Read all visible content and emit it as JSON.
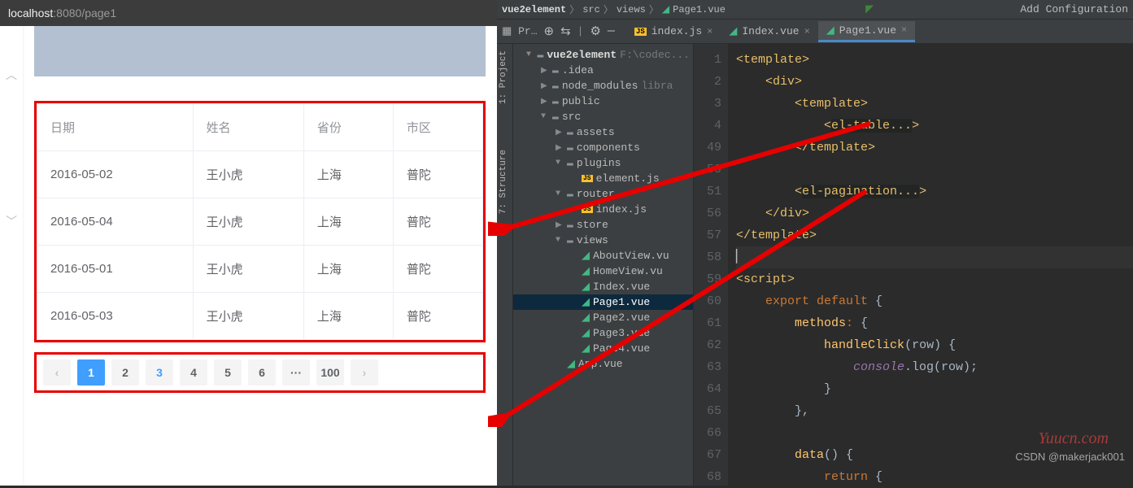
{
  "browser": {
    "host": "localhost",
    "port": ":8080",
    "path": "/page1"
  },
  "table": {
    "headers": [
      "日期",
      "姓名",
      "省份",
      "市区"
    ],
    "rows": [
      {
        "date": "2016-05-02",
        "name": "王小虎",
        "province": "上海",
        "city": "普陀"
      },
      {
        "date": "2016-05-04",
        "name": "王小虎",
        "province": "上海",
        "city": "普陀"
      },
      {
        "date": "2016-05-01",
        "name": "王小虎",
        "province": "上海",
        "city": "普陀"
      },
      {
        "date": "2016-05-03",
        "name": "王小虎",
        "province": "上海",
        "city": "普陀"
      }
    ]
  },
  "pagination": {
    "prev": "‹",
    "pages": [
      "1",
      "2",
      "3",
      "4",
      "5",
      "6",
      "···",
      "100"
    ],
    "next": "›"
  },
  "ide": {
    "breadcrumbs": [
      "vue2element",
      "src",
      "views",
      "Page1.vue"
    ],
    "add_cfg": "Add Configuration",
    "side_project": "1: Project",
    "side_structure": "7: Structure",
    "project_toolbar": "Pr…",
    "tabs": [
      {
        "icon": "js",
        "label": "index.js",
        "close": true
      },
      {
        "icon": "vue",
        "label": "Index.vue",
        "close": true
      },
      {
        "icon": "vue",
        "label": "Page1.vue",
        "close": true,
        "active": true
      }
    ],
    "tree": [
      {
        "ind": 1,
        "arrow": "▼",
        "icon": "fold",
        "label": "vue2element",
        "bold": true,
        "trail": "F:\\codec..."
      },
      {
        "ind": 2,
        "arrow": "▶",
        "icon": "fold",
        "label": ".idea"
      },
      {
        "ind": 2,
        "arrow": "▶",
        "icon": "fold",
        "label": "node_modules",
        "trail": "libra"
      },
      {
        "ind": 2,
        "arrow": "▶",
        "icon": "fold",
        "label": "public"
      },
      {
        "ind": 2,
        "arrow": "▼",
        "icon": "fold",
        "label": "src"
      },
      {
        "ind": 3,
        "arrow": "▶",
        "icon": "fold",
        "label": "assets"
      },
      {
        "ind": 3,
        "arrow": "▶",
        "icon": "fold",
        "label": "components"
      },
      {
        "ind": 3,
        "arrow": "▼",
        "icon": "fold",
        "label": "plugins"
      },
      {
        "ind": 4,
        "arrow": "",
        "icon": "js",
        "label": "element.js"
      },
      {
        "ind": 3,
        "arrow": "▼",
        "icon": "fold",
        "label": "router"
      },
      {
        "ind": 4,
        "arrow": "",
        "icon": "js",
        "label": "index.js"
      },
      {
        "ind": 3,
        "arrow": "▶",
        "icon": "fold",
        "label": "store"
      },
      {
        "ind": 3,
        "arrow": "▼",
        "icon": "fold",
        "label": "views"
      },
      {
        "ind": 4,
        "arrow": "",
        "icon": "vue",
        "label": "AboutView.vu"
      },
      {
        "ind": 4,
        "arrow": "",
        "icon": "vue",
        "label": "HomeView.vu"
      },
      {
        "ind": 4,
        "arrow": "",
        "icon": "vue",
        "label": "Index.vue"
      },
      {
        "ind": 4,
        "arrow": "",
        "icon": "vue",
        "label": "Page1.vue",
        "sel": true
      },
      {
        "ind": 4,
        "arrow": "",
        "icon": "vue",
        "label": "Page2.vue"
      },
      {
        "ind": 4,
        "arrow": "",
        "icon": "vue",
        "label": "Page3.vue"
      },
      {
        "ind": 4,
        "arrow": "",
        "icon": "vue",
        "label": "Page4.vue"
      },
      {
        "ind": 3,
        "arrow": "",
        "icon": "vue",
        "label": "App.vue"
      }
    ],
    "editor": {
      "lines": [
        {
          "n": "1",
          "d": 0,
          "seg": [
            {
              "c": "c-tag",
              "t": "<template>"
            }
          ]
        },
        {
          "n": "2",
          "d": 1,
          "seg": [
            {
              "c": "c-tag",
              "t": "<div>"
            }
          ]
        },
        {
          "n": "3",
          "d": 2,
          "seg": [
            {
              "c": "c-tag",
              "t": "<template>"
            }
          ]
        },
        {
          "n": "4",
          "d": 3,
          "seg": [
            {
              "c": "c-tag",
              "t": "<"
            },
            {
              "c": "c-comp",
              "t": "el-table..."
            },
            {
              "c": "c-tag",
              "t": ">"
            }
          ]
        },
        {
          "n": "49",
          "d": 2,
          "seg": [
            {
              "c": "c-tag",
              "t": "</template>"
            }
          ]
        },
        {
          "n": "50",
          "d": 0,
          "seg": []
        },
        {
          "n": "51",
          "d": 2,
          "seg": [
            {
              "c": "c-tag",
              "t": "<"
            },
            {
              "c": "c-comp",
              "t": "el-pagination..."
            },
            {
              "c": "c-tag",
              "t": ">"
            }
          ]
        },
        {
          "n": "56",
          "d": 1,
          "seg": [
            {
              "c": "c-tag",
              "t": "</div>"
            }
          ]
        },
        {
          "n": "57",
          "d": 0,
          "seg": [
            {
              "c": "c-tag",
              "t": "</template>"
            }
          ]
        },
        {
          "n": "58",
          "d": 0,
          "seg": [],
          "caret": true
        },
        {
          "n": "59",
          "d": 0,
          "seg": [
            {
              "c": "c-tag",
              "t": "<script>"
            }
          ]
        },
        {
          "n": "60",
          "d": 1,
          "seg": [
            {
              "c": "c-kw",
              "t": "export default "
            },
            {
              "c": "c-plain",
              "t": "{"
            }
          ]
        },
        {
          "n": "61",
          "d": 2,
          "seg": [
            {
              "c": "c-name",
              "t": "methods"
            },
            {
              "c": "c-kw",
              "t": ": "
            },
            {
              "c": "c-plain",
              "t": "{"
            }
          ]
        },
        {
          "n": "62",
          "d": 3,
          "seg": [
            {
              "c": "c-name",
              "t": "handleClick"
            },
            {
              "c": "c-plain",
              "t": "("
            },
            {
              "c": "c-param",
              "t": "row"
            },
            {
              "c": "c-plain",
              "t": ") {"
            }
          ]
        },
        {
          "n": "63",
          "d": 4,
          "seg": [
            {
              "c": "c-obj",
              "t": "console"
            },
            {
              "c": "c-plain",
              "t": ".log(row);"
            }
          ]
        },
        {
          "n": "64",
          "d": 3,
          "seg": [
            {
              "c": "c-plain",
              "t": "}"
            }
          ]
        },
        {
          "n": "65",
          "d": 2,
          "seg": [
            {
              "c": "c-plain",
              "t": "},"
            }
          ]
        },
        {
          "n": "66",
          "d": 0,
          "seg": []
        },
        {
          "n": "67",
          "d": 2,
          "seg": [
            {
              "c": "c-name",
              "t": "data"
            },
            {
              "c": "c-plain",
              "t": "() {"
            }
          ]
        },
        {
          "n": "68",
          "d": 3,
          "seg": [
            {
              "c": "c-kw",
              "t": "return "
            },
            {
              "c": "c-plain",
              "t": "{"
            }
          ]
        }
      ]
    }
  },
  "watermark": "CSDN @makerjack001",
  "watermark2": "Yuucn.com"
}
